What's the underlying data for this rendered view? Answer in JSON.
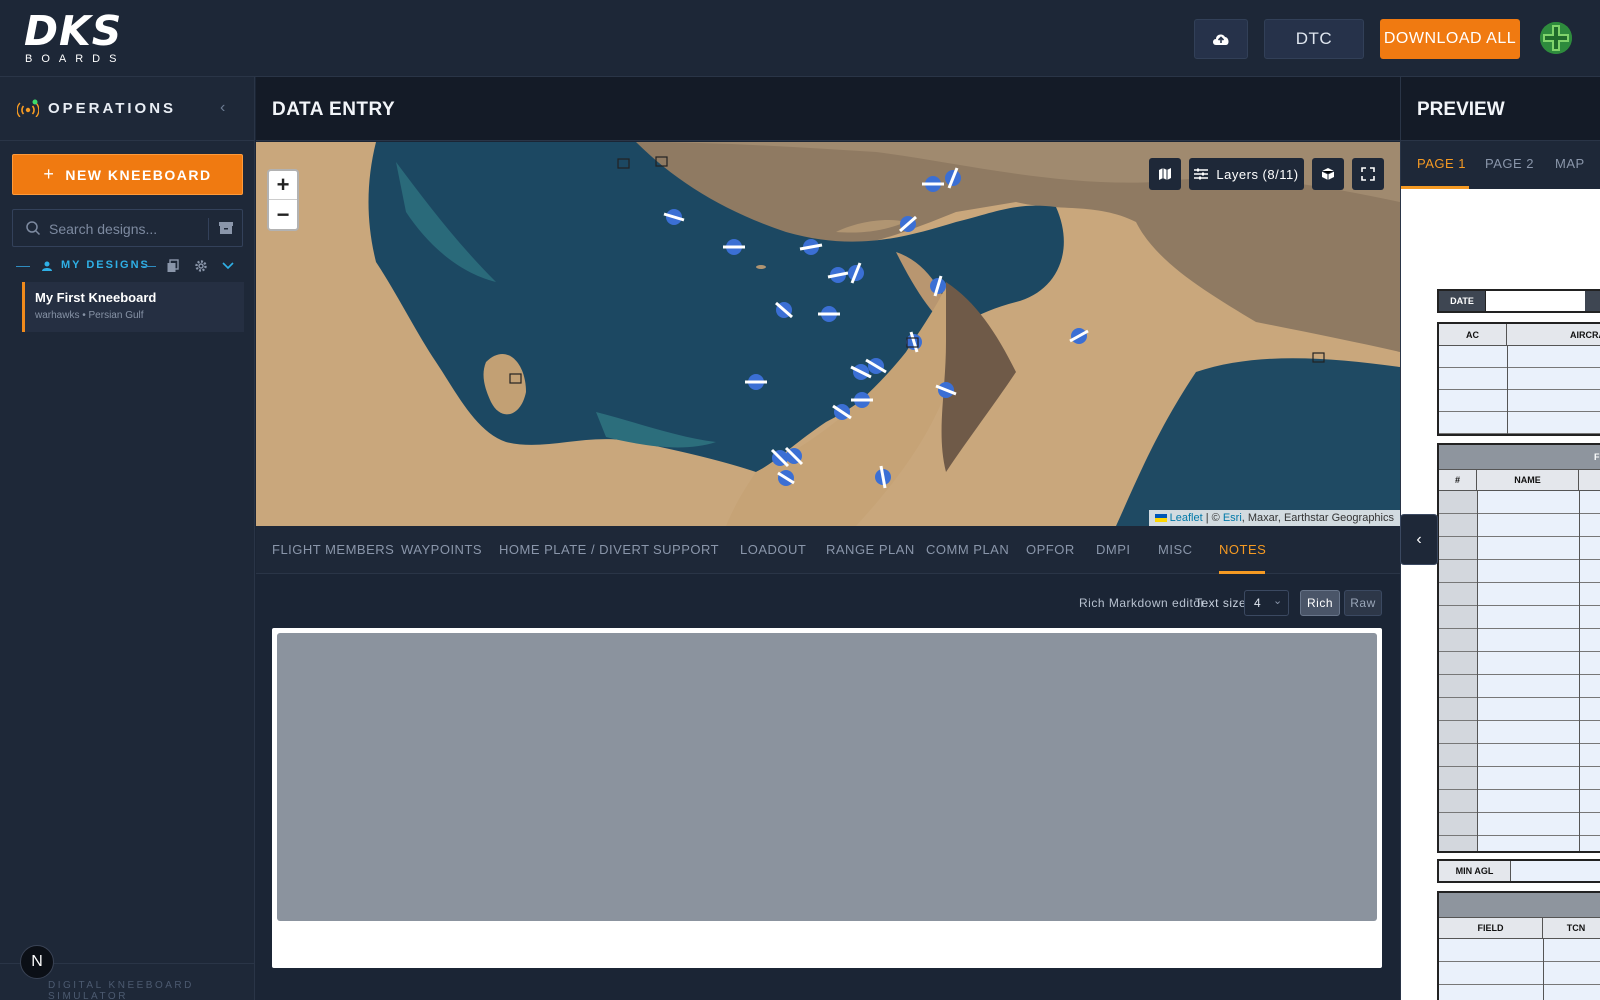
{
  "brand": {
    "logo_main": "DKS",
    "logo_sub": "BOARDS"
  },
  "topbar": {
    "dtc_label": "DTC",
    "download_label": "DOWNLOAD ALL"
  },
  "sidebar": {
    "title": "OPERATIONS",
    "new_button": "NEW KNEEBOARD",
    "search_placeholder": "Search designs...",
    "designs_label": "MY DESIGNS",
    "designs": [
      {
        "name": "My First Kneeboard",
        "subtitle": "warhawks • Persian Gulf"
      }
    ],
    "footer": "DIGITAL KNEEBOARD SIMULATOR",
    "badge": "N"
  },
  "data_entry": {
    "title": "DATA ENTRY",
    "map": {
      "zoom_in": "+",
      "zoom_out": "−",
      "layers_label": "Layers (8/11)",
      "attribution_leaflet": "Leaflet",
      "attribution_sep": " | © ",
      "attribution_esri": "Esri",
      "attribution_rest": ", Maxar, Earthstar Geographics"
    },
    "tabs": [
      "FLIGHT MEMBERS",
      "WAYPOINTS",
      "HOME PLATE / DIVERT",
      "SUPPORT",
      "LOADOUT",
      "RANGE PLAN",
      "COMM PLAN",
      "OPFOR",
      "DMPI",
      "MISC",
      "NOTES"
    ],
    "active_tab": "NOTES",
    "notes": {
      "editor_label": "Rich Markdown editor",
      "text_size_label": "Text size:",
      "text_size_value": "4",
      "rich_label": "Rich",
      "raw_label": "Raw"
    }
  },
  "preview": {
    "title": "PREVIEW",
    "tabs": [
      "PAGE 1",
      "PAGE 2",
      "MAP"
    ],
    "active_tab": "PAGE 1",
    "sheet": {
      "date_label": "DATE",
      "ac_label": "AC",
      "aircraft_label": "AIRCRA",
      "flight_label": "FL",
      "num_label": "#",
      "name_label": "NAME",
      "min_agl_label": "MIN AGL",
      "field_label": "FIELD",
      "tcn_label": "TCN"
    }
  },
  "colors": {
    "accent": "#f07a11",
    "active_tab": "#f59a23",
    "designs_label": "#2fb0e6"
  }
}
